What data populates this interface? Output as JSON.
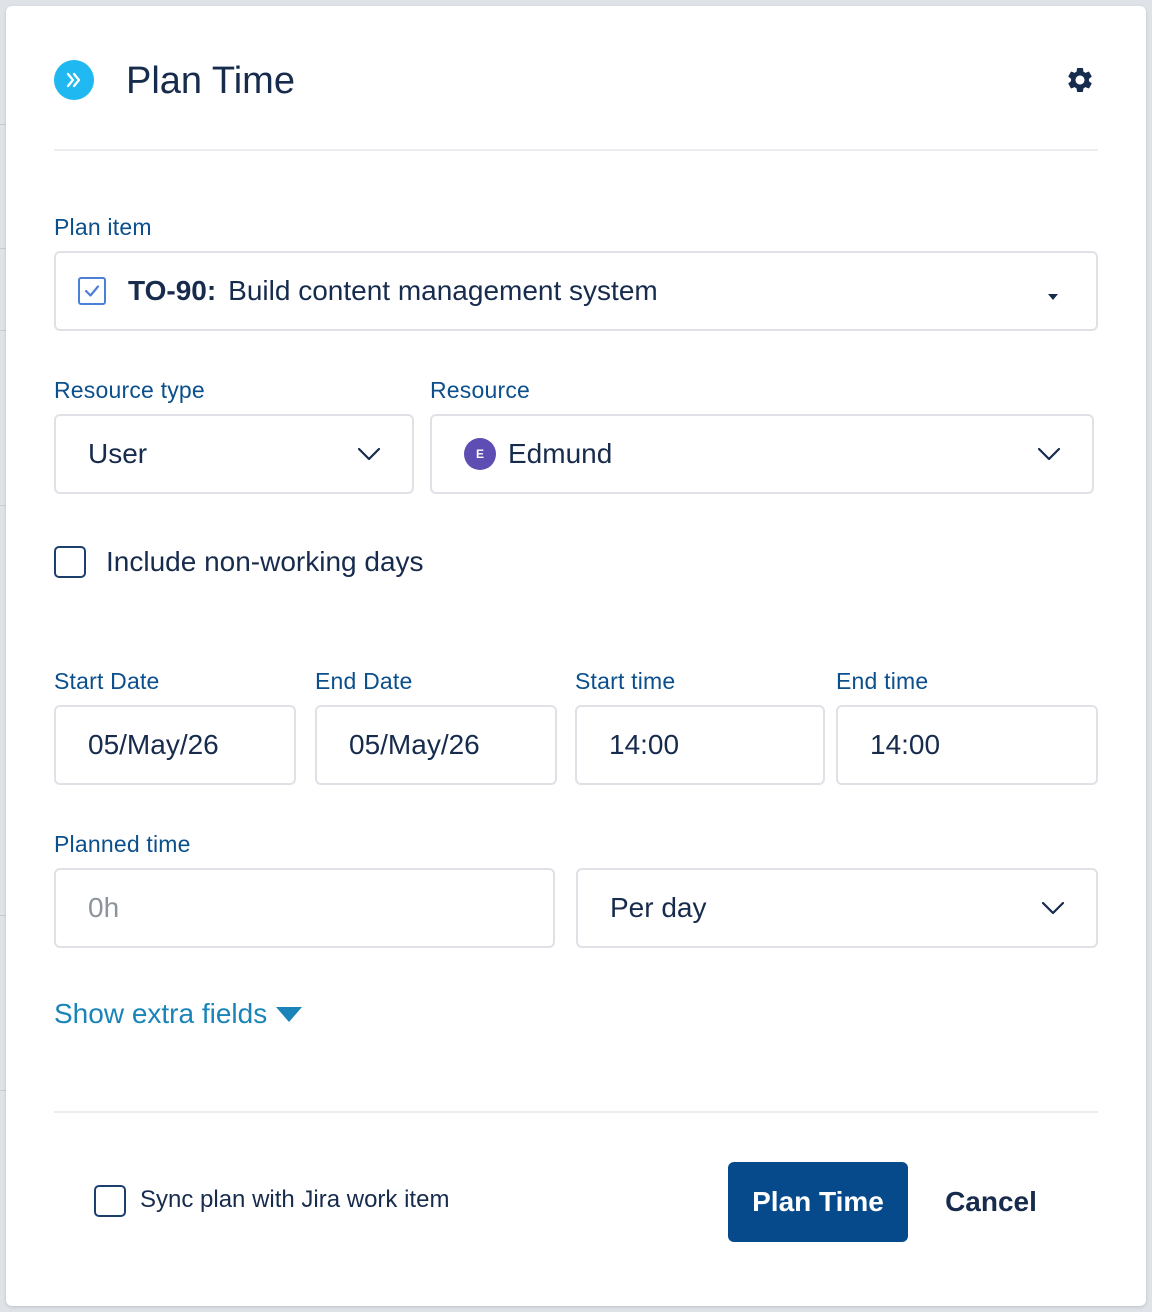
{
  "dialog": {
    "title": "Plan Time",
    "logo_icon": "double-chevron-right-icon",
    "settings_icon": "gear-icon"
  },
  "plan_item": {
    "label": "Plan item",
    "key": "TO-90:",
    "summary": "Build content management system",
    "checked": true
  },
  "resource_type": {
    "label": "Resource type",
    "value": "User"
  },
  "resource": {
    "label": "Resource",
    "avatar_initial": "E",
    "value": "Edmund"
  },
  "include_non_working": {
    "label": "Include non-working days",
    "checked": false
  },
  "dates": {
    "start_date_label": "Start Date",
    "start_date": "05/May/26",
    "end_date_label": "End Date",
    "end_date": "05/May/26",
    "start_time_label": "Start time",
    "start_time": "14:00",
    "end_time_label": "End time",
    "end_time": "14:00"
  },
  "planned_time": {
    "label": "Planned time",
    "placeholder": "0h",
    "value": "",
    "period": "Per day"
  },
  "extra_fields": {
    "label": "Show extra fields"
  },
  "footer": {
    "sync_label": "Sync plan with Jira work item",
    "sync_checked": false,
    "primary_label": "Plan Time",
    "cancel_label": "Cancel"
  },
  "colors": {
    "accent": "#064a8b",
    "label": "#0b4f8c",
    "link": "#1a84b8",
    "logo": "#1fb8f0",
    "avatar": "#5e4db2"
  }
}
